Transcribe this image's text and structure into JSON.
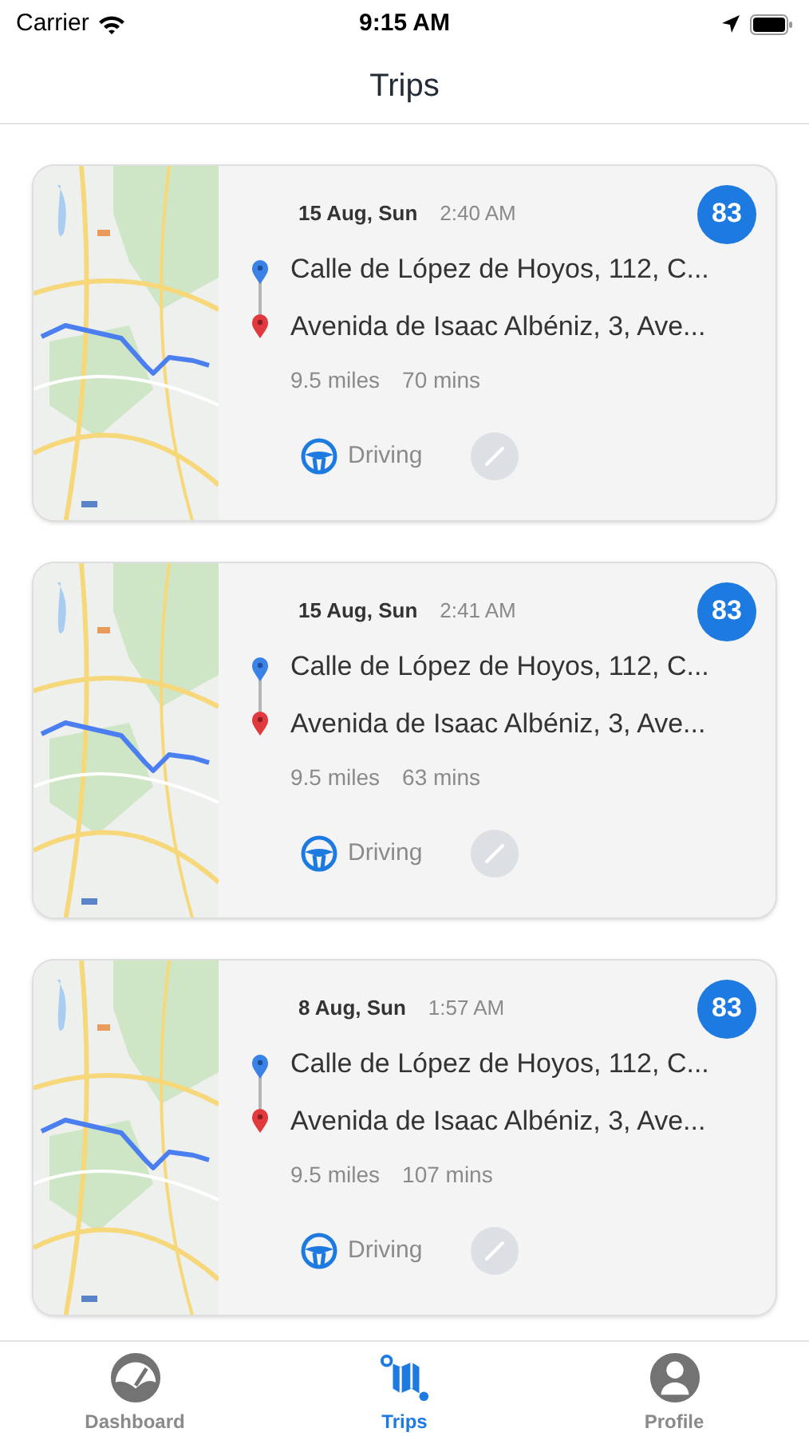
{
  "status_bar": {
    "carrier": "Carrier",
    "time": "9:15 AM"
  },
  "nav": {
    "title": "Trips"
  },
  "trips": [
    {
      "date": "15 Aug, Sun",
      "time": "2:40 AM",
      "score": "83",
      "start": "Calle de López de Hoyos, 112, C...",
      "end": "Avenida de Isaac Albéniz, 3, Ave...",
      "distance": "9.5 miles",
      "duration": "70 mins",
      "mode": "Driving",
      "edit_disabled": true
    },
    {
      "date": "15 Aug, Sun",
      "time": "2:41 AM",
      "score": "83",
      "start": "Calle de López de Hoyos, 112, C...",
      "end": "Avenida de Isaac Albéniz, 3, Ave...",
      "distance": "9.5 miles",
      "duration": "63 mins",
      "mode": "Driving",
      "edit_disabled": true
    },
    {
      "date": "8 Aug, Sun",
      "time": "1:57 AM",
      "score": "83",
      "start": "Calle de López de Hoyos, 112, C...",
      "end": "Avenida de Isaac Albéniz, 3, Ave...",
      "distance": "9.5 miles",
      "duration": "107 mins",
      "mode": "Driving",
      "edit_disabled": true
    }
  ],
  "tab_bar": [
    {
      "kind": "dashboard",
      "label": "Dashboard",
      "selected": false
    },
    {
      "kind": "trips",
      "label": "Trips",
      "selected": true
    },
    {
      "kind": "profile",
      "label": "Profile",
      "selected": false
    }
  ]
}
